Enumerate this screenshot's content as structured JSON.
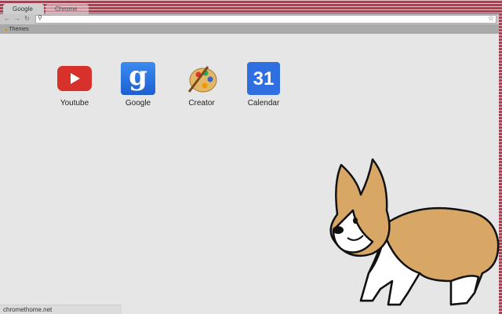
{
  "tabs": [
    {
      "label": "Google"
    },
    {
      "label": "Chrome"
    }
  ],
  "bookmarks": [
    {
      "label": "Themes"
    }
  ],
  "apps": [
    {
      "label": "Youtube",
      "icon": "youtube-icon"
    },
    {
      "label": "Google",
      "icon": "google-icon"
    },
    {
      "label": "Creator",
      "icon": "palette-icon"
    },
    {
      "label": "Calendar",
      "icon": "calendar-icon",
      "day": "31"
    }
  ],
  "status": "chromethome.net"
}
